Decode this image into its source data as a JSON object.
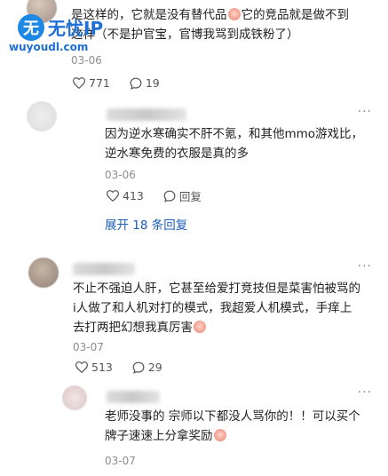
{
  "watermark": {
    "badge": "无",
    "title": "无忧IP",
    "url": "wuyoudl.com"
  },
  "comments": [
    {
      "lines": [
        "是这样的，它就是没有替代品",
        "它的竞品就是做不到",
        "这样（不是护官宝，官博我骂到成铁粉了）"
      ],
      "time": "03-06",
      "likes": "771",
      "replies": "19"
    },
    {
      "lines": [
        "因为逆水寒确实不肝不氪，和其他mmo游戏比，",
        "逆水寒免费的衣服是真的多"
      ],
      "time": "03-06",
      "likes": "413",
      "reply_label": "回复",
      "expand": "展开 18 条回复"
    },
    {
      "lines": [
        "不止不强迫人肝，它甚至给爱打竞技但是菜害怕被骂的",
        "i人做了和人机对打的模式，我超爱人机模式，手痒上",
        "去打两把幻想我真厉害"
      ],
      "time": "03-07",
      "likes": "513",
      "replies": "29"
    },
    {
      "lines": [
        "老师没事的 宗师以下都没人骂你的！！可以买个",
        "牌子速速上分拿奖励"
      ],
      "time": "03-07"
    }
  ],
  "icons": {
    "like": "heart-icon",
    "reply": "comment-icon",
    "more": "more-icon"
  },
  "colors": {
    "link": "#1d5fbd",
    "watermark": "#1e6fd6"
  }
}
